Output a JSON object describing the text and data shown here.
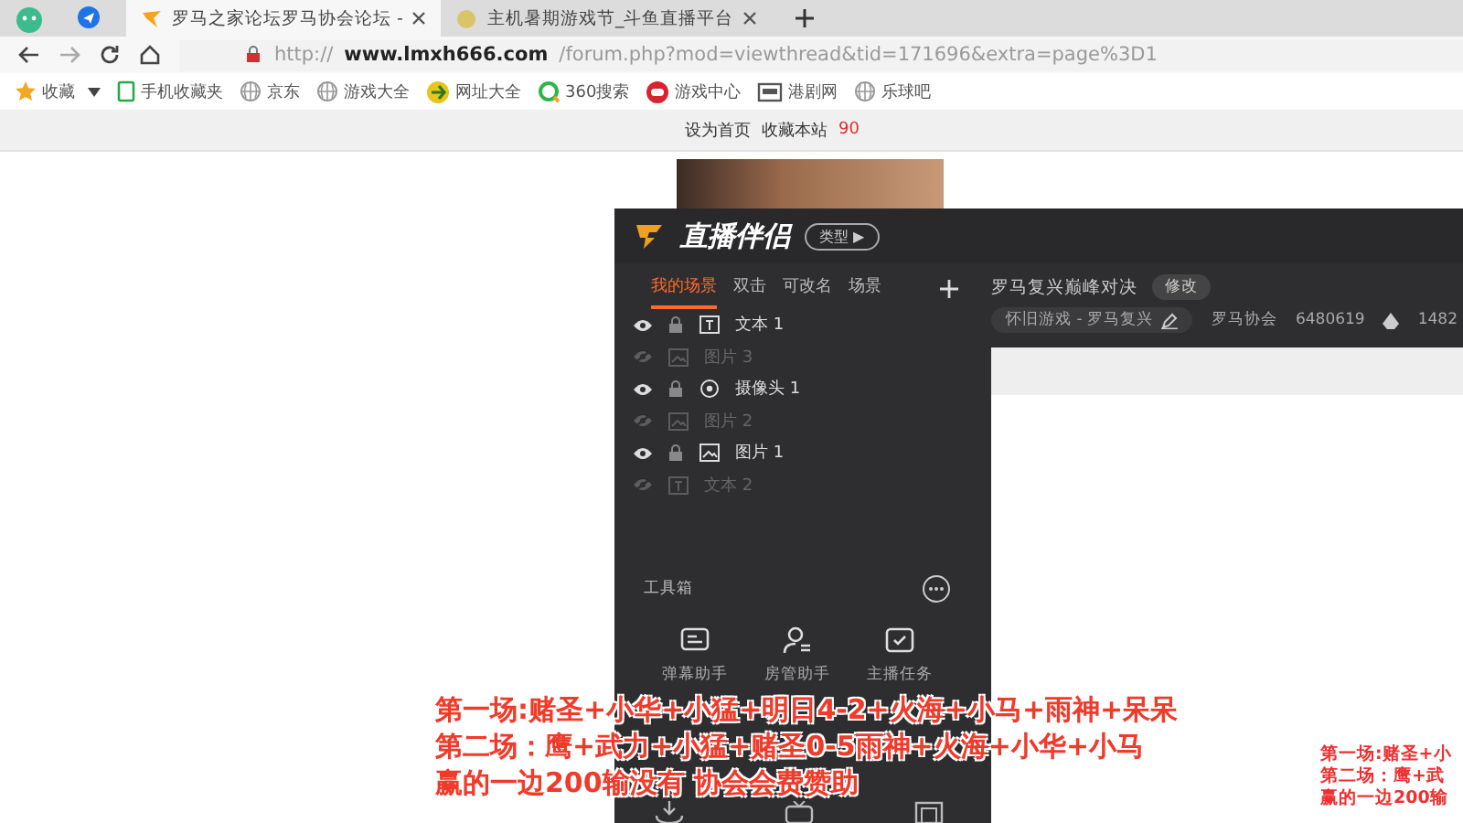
{
  "browser": {
    "tabs": [
      {
        "title": "罗马之家论坛罗马协会论坛 - ",
        "selected": true
      },
      {
        "title": "主机暑期游戏节_斗鱼直播平台",
        "selected": false
      }
    ],
    "url": {
      "prefix": "http://",
      "host": "www.lmxh666.com",
      "path": "/forum.php?mod=viewthread&tid=171696&extra=page%3D1"
    },
    "bookmarks": [
      {
        "label": "收藏",
        "kind": "star"
      },
      {
        "label": "手机收藏夹",
        "kind": "phone"
      },
      {
        "label": "京东",
        "kind": "globe"
      },
      {
        "label": "游戏大全",
        "kind": "globe"
      },
      {
        "label": "网址大全",
        "kind": "ball"
      },
      {
        "label": "360搜索",
        "kind": "search"
      },
      {
        "label": "游戏中心",
        "kind": "game"
      },
      {
        "label": "港剧网",
        "kind": "tv"
      },
      {
        "label": "乐球吧",
        "kind": "globe"
      }
    ]
  },
  "site_bar": {
    "links": [
      "设为首页",
      "收藏本站"
    ],
    "count": "90"
  },
  "app": {
    "title": "直播伴侣",
    "type_button": "类型 ▶",
    "scene_tabs": [
      {
        "label": "我的场景",
        "selected": true
      },
      {
        "label": "双击",
        "selected": false
      },
      {
        "label": "可改名",
        "selected": false
      },
      {
        "label": "场景",
        "selected": false
      }
    ],
    "sources": [
      {
        "name": "文本 1",
        "kind": "text",
        "visible": true
      },
      {
        "name": "图片 3",
        "kind": "image",
        "visible": false
      },
      {
        "name": "摄像头 1",
        "kind": "camera",
        "visible": true
      },
      {
        "name": "图片 2",
        "kind": "image",
        "visible": false
      },
      {
        "name": "图片 1",
        "kind": "image",
        "visible": true
      },
      {
        "name": "文本 2",
        "kind": "text",
        "visible": false
      }
    ],
    "stream_title": "罗马复兴巅峰对决",
    "edit_button": "修改",
    "category": "怀旧游戏 - 罗马复兴",
    "room_name": "罗马协会",
    "room_id": "6480619",
    "popularity": "1482",
    "toolbox": {
      "title": "工具箱",
      "tools": [
        {
          "label": "弹幕助手",
          "kind": "chat"
        },
        {
          "label": "房管助手",
          "kind": "user"
        },
        {
          "label": "主播任务",
          "kind": "task"
        }
      ]
    }
  },
  "captions": [
    "第一场:赌圣+小华+小猛+明日4-2+火海+小马+雨神+呆呆",
    "第二场：鹰+武力+小猛+赌圣0-5雨神+火海+小华+小马",
    "赢的一边200输没有 协会会费赞助"
  ],
  "preview_captions": [
    "第一场:赌圣+小",
    "第二场：鹰+武",
    "赢的一边200输"
  ]
}
